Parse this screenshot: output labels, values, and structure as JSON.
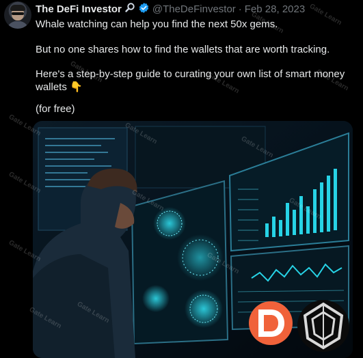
{
  "author": {
    "display_name": "The DeFi Investor",
    "handle": "@TheDeFinvestor",
    "separator": "·",
    "date": "Feb 28, 2023"
  },
  "tweet": {
    "lines": [
      "Whale watching can help you find the next 50x gems.",
      "But no one shares how to find the wallets that are worth tracking.",
      "Here's a step-by-step guide to curating your own list of smart money",
      "wallets 👇",
      "(for free)"
    ]
  },
  "icons": {
    "badge_1": "magnifier-icon",
    "badge_2": "verified-badge-icon",
    "media_logo_1": "db-logo-icon",
    "media_logo_2": "arkham-logo-icon"
  },
  "watermark": "Gate Learn",
  "colors": {
    "background": "#000000",
    "text": "#e7e9ea",
    "muted": "#71767b",
    "verified": "#1d9bf0",
    "screen_cyan": "#27d3e6"
  }
}
